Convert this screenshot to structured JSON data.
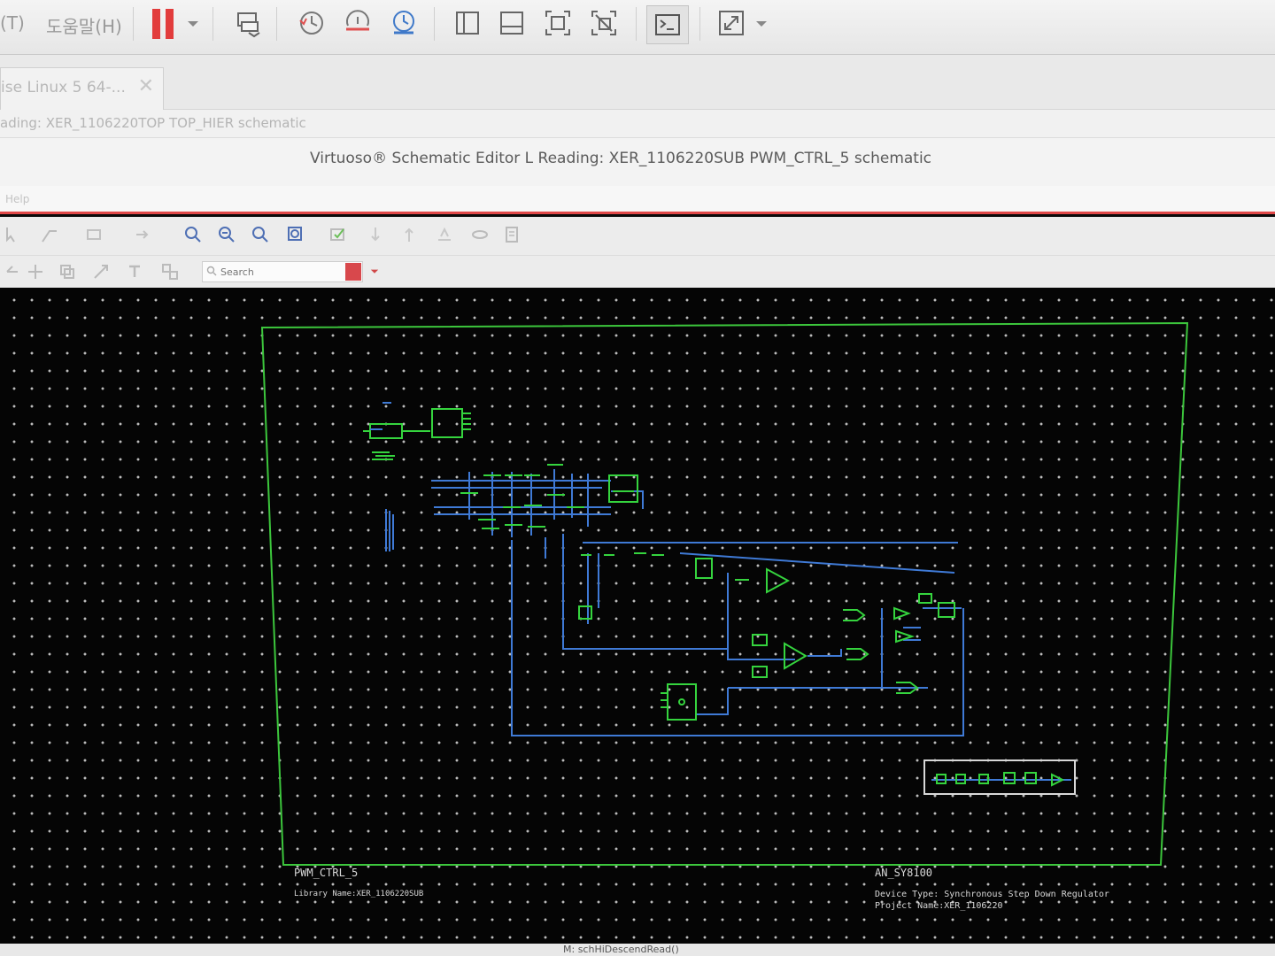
{
  "host_toolbar": {
    "menu_left": "(T)",
    "menu_help": "도움말(H)",
    "buttons": [
      "pause",
      "vm-settings",
      "snapshot",
      "revert-snapshot",
      "snapshot-manager",
      "sidebar",
      "thumbnail-bar",
      "fit-window",
      "no-fit",
      "console",
      "fullscreen"
    ]
  },
  "tabs": [
    {
      "label": "ise Linux 5 64-...",
      "active": true
    }
  ],
  "previous_window_title": "ading: XER_1106220TOP TOP_HIER schematic",
  "window_title": "Virtuoso® Schematic Editor L Reading: XER_1106220SUB PWM_CTRL_5 schematic",
  "menu_bar": {
    "text": "Help"
  },
  "toolbar": {
    "search": {
      "placeholder": "Search"
    }
  },
  "sheet": {
    "cell_name": "PWM_CTRL_5",
    "library_name": "Library Name:XER_1106220SUB",
    "part_number": "AN_SY8100",
    "device_type": "Device Type:  Synchronous Step Down Regulator",
    "project_name": "Project Name:XER_1106220"
  },
  "status_bar": {
    "text": "M: schHiDescendRead()"
  },
  "colors": {
    "wire": "#3f7ad6",
    "component": "#35d43e",
    "border": "#3cc63c",
    "accent": "#e04848"
  }
}
